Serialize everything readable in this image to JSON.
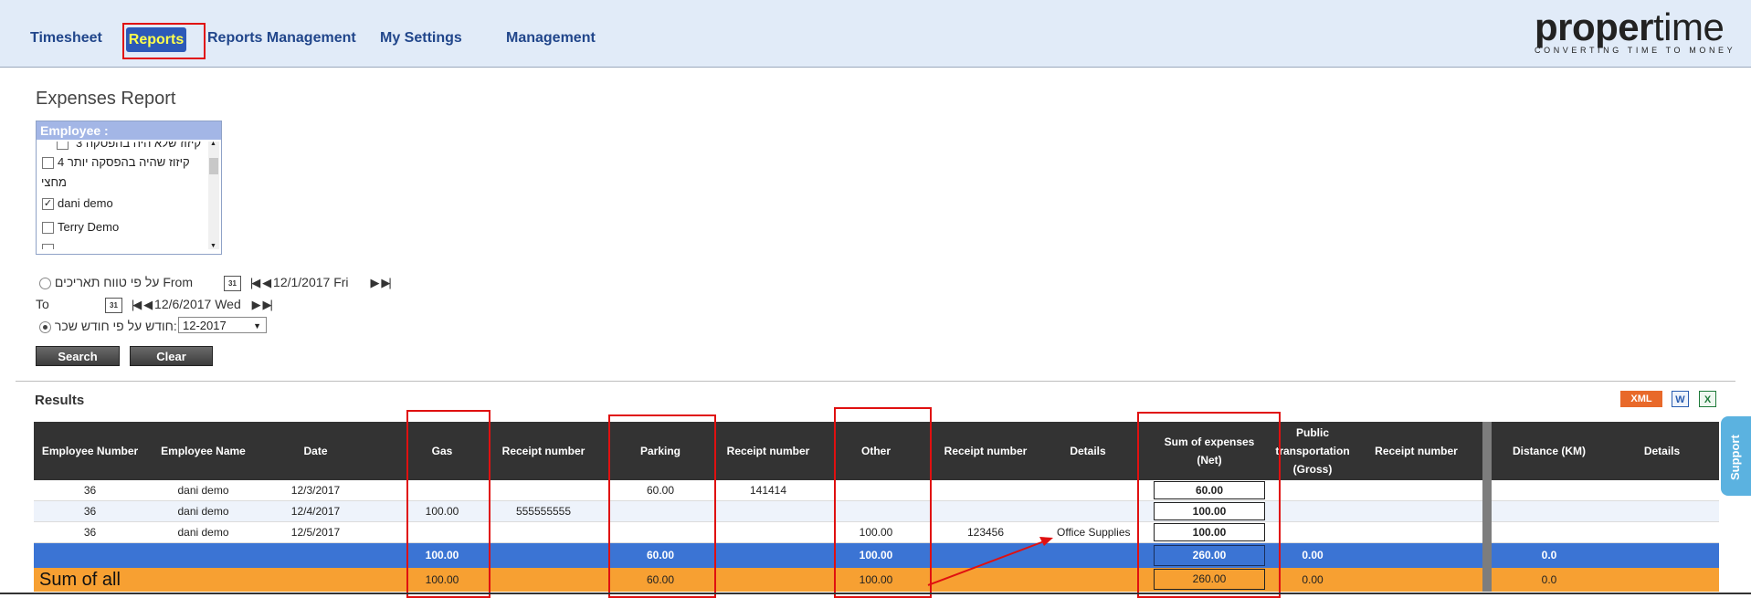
{
  "nav": {
    "items": [
      "Timesheet",
      "Reports",
      "Reports Management",
      "My Settings",
      "Management"
    ]
  },
  "logo": {
    "proper": "proper",
    "time": "time",
    "tagline": "CONVERTING TIME TO MONEY"
  },
  "page_title": "Expenses Report",
  "employee_filter": {
    "label": "Employee :",
    "items": [
      {
        "label": "קיזוז שלא היה בהפסקה 3",
        "checked": false
      },
      {
        "label": "קיזוז שהיה בהפסקה יותר 4",
        "checked": false
      },
      {
        "label": "מחצי",
        "checked": false
      },
      {
        "label": "dani demo",
        "checked": true
      },
      {
        "label": "Terry Demo",
        "checked": false
      }
    ]
  },
  "date_filter": {
    "range_label": "על פי טווח תאריכים From",
    "from_date": "12/1/2017 Fri",
    "to_label": "To",
    "to_date": "12/6/2017 Wed",
    "month_label": "חודש על פי חודש שכר:",
    "month_value": "12-2017",
    "calendar_glyph": "31"
  },
  "buttons": {
    "search": "Search",
    "clear": "Clear"
  },
  "results_label": "Results",
  "export": {
    "xml": "XML",
    "word": "W",
    "excel": "X"
  },
  "table": {
    "headers": [
      "Employee Number",
      "Employee Name",
      "Date",
      "Gas",
      "Receipt number",
      "Parking",
      "Receipt number",
      "Other",
      "Receipt number",
      "Details",
      "Sum of expenses (Net)",
      "Public transportation (Gross)",
      "Receipt number",
      "Distance (KM)",
      "Details"
    ],
    "rows": [
      {
        "emp_no": "36",
        "name": "dani demo",
        "date": "12/3/2017",
        "gas": "",
        "gas_receipt": "",
        "parking": "60.00",
        "parking_receipt": "141414",
        "other": "",
        "other_receipt": "",
        "details": "",
        "net": "60.00"
      },
      {
        "emp_no": "36",
        "name": "dani demo",
        "date": "12/4/2017",
        "gas": "100.00",
        "gas_receipt": "555555555",
        "parking": "",
        "parking_receipt": "",
        "other": "",
        "other_receipt": "",
        "details": "",
        "net": "100.00"
      },
      {
        "emp_no": "36",
        "name": "dani demo",
        "date": "12/5/2017",
        "gas": "",
        "gas_receipt": "",
        "parking": "",
        "parking_receipt": "",
        "other": "100.00",
        "other_receipt": "123456",
        "details": "Office Supplies",
        "net": "100.00"
      }
    ],
    "subtotal": {
      "gas": "100.00",
      "parking": "60.00",
      "other": "100.00",
      "net": "260.00",
      "public": "0.00",
      "distance": "0.0"
    },
    "sum_of_all": {
      "label": "Sum of all",
      "gas": "100.00",
      "parking": "60.00",
      "other": "100.00",
      "net": "260.00",
      "public": "0.00",
      "distance": "0.0"
    }
  },
  "support_label": "Support",
  "colors": {
    "nav_active": "#2c59b8",
    "highlight_red": "#e01010",
    "subtotal_blue": "#3b74d4",
    "sum_orange": "#f7a032",
    "header_dark": "#333333"
  }
}
